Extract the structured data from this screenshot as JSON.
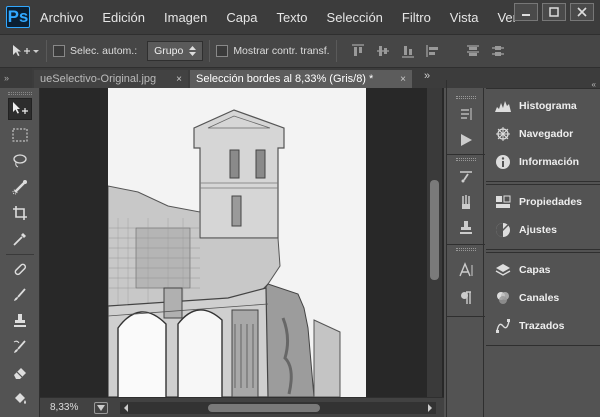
{
  "app": {
    "logo": "Ps"
  },
  "menu": [
    "Archivo",
    "Edición",
    "Imagen",
    "Capa",
    "Texto",
    "Selección",
    "Filtro",
    "Vista",
    "Ver"
  ],
  "options": {
    "auto_select_label": "Selec. autom.:",
    "group_value": "Grupo",
    "show_transform_label": "Mostrar contr. transf."
  },
  "tabs": [
    {
      "label": "ueSelectivo-Original.jpg",
      "close": "×"
    },
    {
      "label": "Selección bordes al 8,33% (Gris/8) *",
      "close": "×"
    }
  ],
  "tabs_more": "»",
  "status": {
    "zoom": "8,33%"
  },
  "panels": {
    "group1": [
      "Histograma",
      "Navegador",
      "Información"
    ],
    "group2": [
      "Propiedades",
      "Ajustes"
    ],
    "group3": [
      "Capas",
      "Canales",
      "Trazados"
    ]
  },
  "collapse_glyph": "«",
  "expand_glyph": "»",
  "colors": {
    "accent": "#31a8ff",
    "bg": "#535353",
    "dark": "#282828"
  }
}
